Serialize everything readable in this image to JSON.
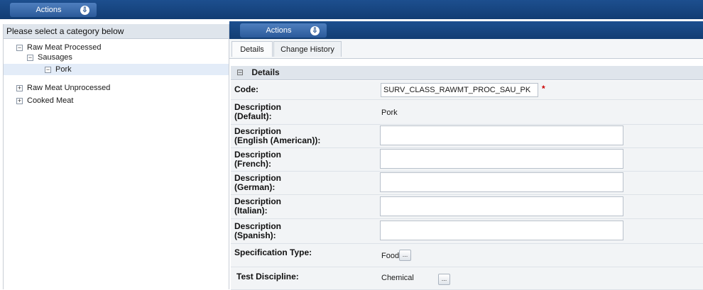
{
  "top_actions": {
    "label": "Actions"
  },
  "left_panel": {
    "header": "Please select a category below",
    "tree": [
      {
        "label": "Raw Meat Processed",
        "toggle": "−"
      },
      {
        "label": "Sausages",
        "toggle": "−"
      },
      {
        "label": "Pork",
        "toggle": "−"
      },
      {
        "label": "Raw Meat Unprocessed",
        "toggle": "+"
      },
      {
        "label": "Cooked Meat",
        "toggle": "+"
      }
    ]
  },
  "right_actions": {
    "label": "Actions"
  },
  "tabs": [
    {
      "label": "Details"
    },
    {
      "label": "Change History"
    }
  ],
  "details": {
    "section_title": "Details",
    "collapse_glyph": "⊟",
    "code": {
      "label": "Code:",
      "value": "SURV_CLASS_RAWMT_PROC_SAU_PK",
      "required_mark": "*"
    },
    "desc_default": {
      "line1": "Description",
      "line2": "(Default):",
      "value": "Pork"
    },
    "desc_english": {
      "line1": "Description",
      "line2": "(English (American)):",
      "value": ""
    },
    "desc_french": {
      "line1": "Description",
      "line2": "(French):",
      "value": ""
    },
    "desc_german": {
      "line1": "Description",
      "line2": "(German):",
      "value": ""
    },
    "desc_italian": {
      "line1": "Description",
      "line2": "(Italian):",
      "value": ""
    },
    "desc_spanish": {
      "line1": "Description",
      "line2": "(Spanish):",
      "value": ""
    },
    "spec_type": {
      "label": "Specification Type:",
      "value": "Food",
      "button": "..."
    },
    "test_discipline": {
      "label": "Test Discipline:",
      "value": "Chemical",
      "button": "..."
    }
  },
  "icons": {
    "download": "⇩"
  },
  "colors": {
    "nav_blue": "#1a4886",
    "button_blue": "#3d6cab",
    "required": "#cc0000"
  }
}
